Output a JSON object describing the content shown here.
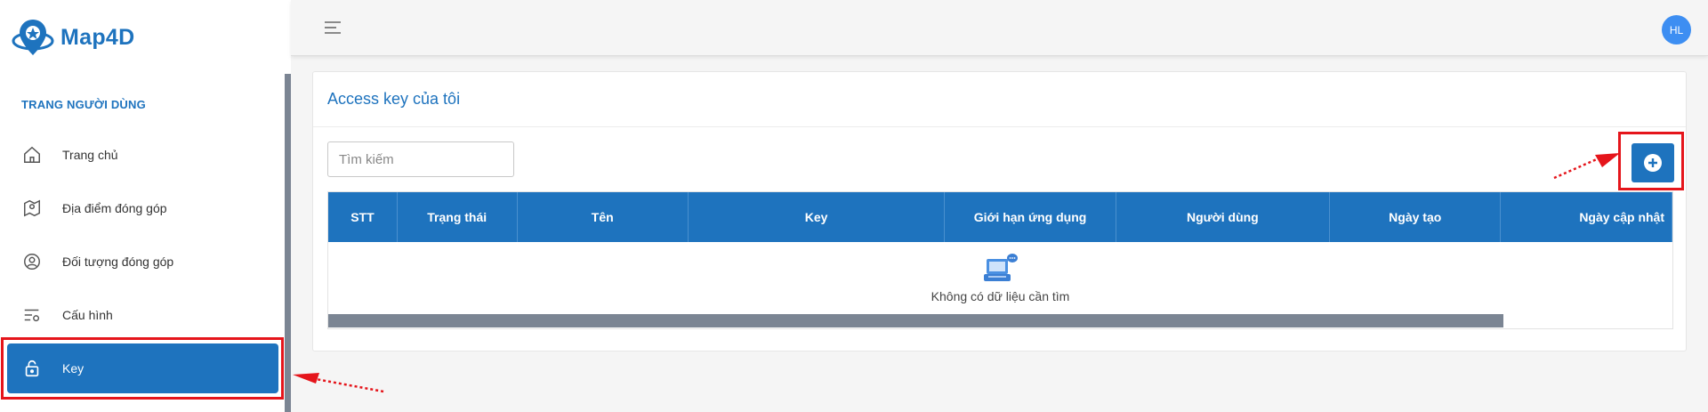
{
  "app": {
    "name": "Map4D"
  },
  "sidebar": {
    "section_title": "TRANG NGƯỜI DÙNG",
    "items": [
      {
        "label": "Trang chủ",
        "icon": "home-icon"
      },
      {
        "label": "Địa điểm đóng góp",
        "icon": "map-pin-icon"
      },
      {
        "label": "Đối tượng đóng góp",
        "icon": "user-pin-icon"
      },
      {
        "label": "Cấu hình",
        "icon": "settings-list-icon"
      },
      {
        "label": "Key",
        "icon": "lock-icon",
        "active": true
      }
    ]
  },
  "header": {
    "avatar_initials": "HL"
  },
  "main": {
    "title": "Access key của tôi",
    "search": {
      "placeholder": "Tìm kiếm",
      "value": ""
    },
    "table": {
      "columns": [
        "STT",
        "Trạng thái",
        "Tên",
        "Key",
        "Giới hạn ứng dụng",
        "Người dùng",
        "Ngày tạo",
        "Ngày cập nhật"
      ],
      "rows": [],
      "empty_text": "Không có dữ liệu cần tìm"
    }
  },
  "colors": {
    "primary": "#1e73be",
    "highlight": "#e5151b",
    "avatar": "#3d8ef2"
  }
}
